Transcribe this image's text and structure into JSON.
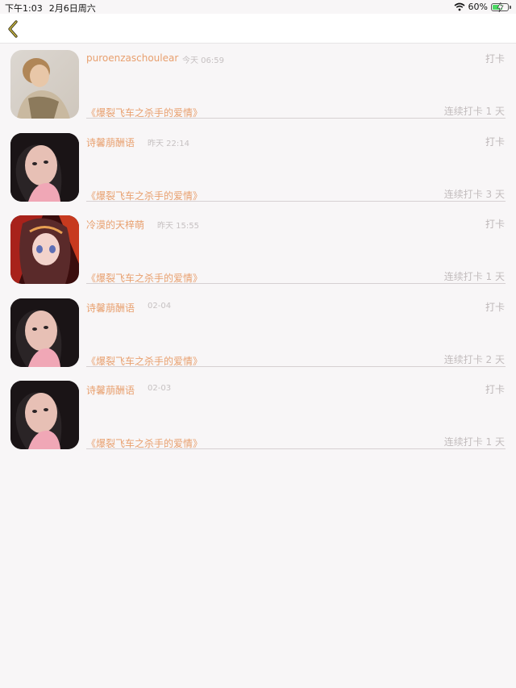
{
  "status_bar": {
    "time": "下午1:03",
    "date": "2月6日周六",
    "battery": "60%"
  },
  "colors": {
    "accent": "#e8a06f",
    "back_icon": "#b5a23a",
    "battery_fill": "#4cd964"
  },
  "nav": {
    "back_icon": "chevron-left-icon"
  },
  "entries": [
    {
      "name": "puroenzaschoulear",
      "time": "今天 06:59",
      "type": "打卡",
      "book": "《爆裂飞车之杀手的爱情》",
      "streak": "连续打卡 1 天"
    },
    {
      "name": "诗馨萠酬语",
      "time": "昨天 22:14",
      "type": "打卡",
      "book": "《爆裂飞车之杀手的爱情》",
      "streak": "连续打卡 3 天"
    },
    {
      "name": "冷漠的天梓萌",
      "time": "昨天 15:55",
      "type": "打卡",
      "book": "《爆裂飞车之杀手的爱情》",
      "streak": "连续打卡 1 天"
    },
    {
      "name": "诗馨萠酬语",
      "time": "02-04",
      "type": "打卡",
      "book": "《爆裂飞车之杀手的爱情》",
      "streak": "连续打卡 2 天"
    },
    {
      "name": "诗馨萠酬语",
      "time": "02-03",
      "type": "打卡",
      "book": "《爆裂飞车之杀手的爱情》",
      "streak": "连续打卡 1 天"
    }
  ]
}
